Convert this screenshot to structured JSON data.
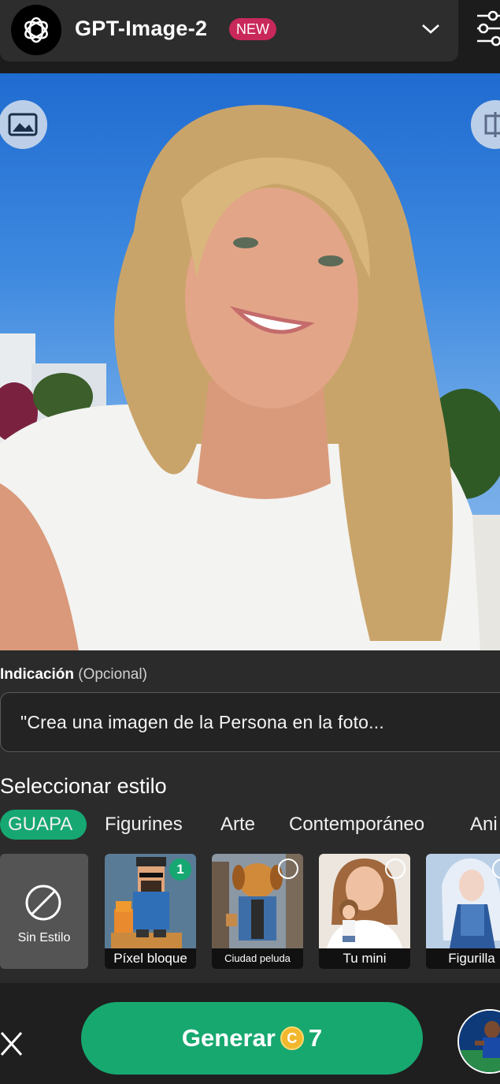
{
  "header": {
    "model_name": "GPT-Image-2",
    "badge": "NEW",
    "logo_icon": "openai-logo-icon",
    "dropdown_icon": "chevron-down-icon",
    "settings_icon": "sliders-icon"
  },
  "photo": {
    "gallery_icon": "image-icon",
    "compare_icon": "compare-split-icon"
  },
  "prompt": {
    "label": "Indicación",
    "optional": "(Opcional)",
    "value": "\"Crea una imagen de la Persona en la foto..."
  },
  "styles": {
    "title": "Seleccionar estilo",
    "tabs": [
      {
        "label": "GUAPA",
        "active": true
      },
      {
        "label": "Figurines"
      },
      {
        "label": "Arte"
      },
      {
        "label": "Contemporáneo"
      },
      {
        "label": "Ani"
      }
    ],
    "cards": [
      {
        "label": "Sin Estilo",
        "icon": "no-style-icon"
      },
      {
        "label": "Píxel bloque",
        "selected_count": "1"
      },
      {
        "label": "Ciudad peluda"
      },
      {
        "label": "Tu mini"
      },
      {
        "label": "Figurilla"
      }
    ]
  },
  "footer": {
    "close_icon": "close-icon",
    "generate_label": "Generar",
    "coin_symbol": "C",
    "cost": "7"
  },
  "colors": {
    "accent": "#17a870",
    "badge": "#c9285b",
    "background": "#2b2b2b"
  }
}
